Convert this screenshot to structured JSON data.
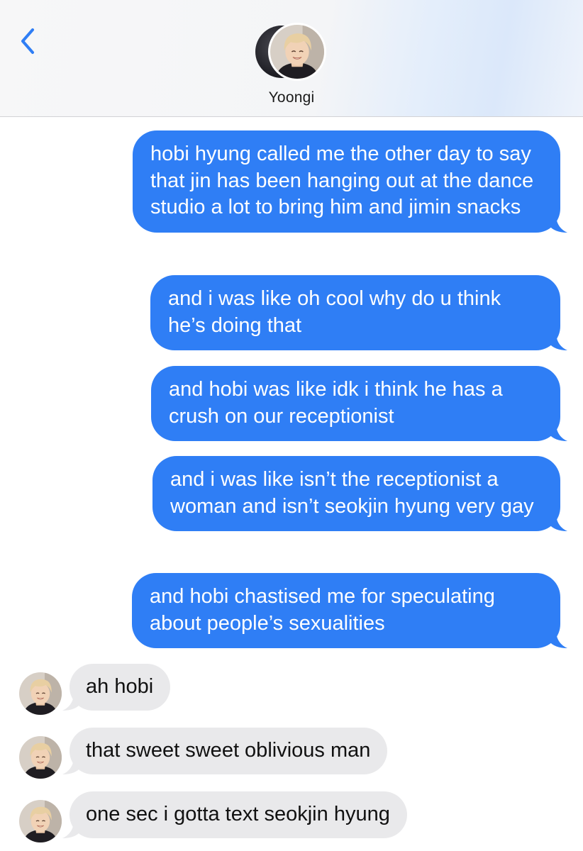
{
  "header": {
    "contact_name": "Yoongi",
    "back_icon": "chevron-left-icon",
    "accent_color": "#2f7ef5"
  },
  "messages": {
    "m1": "hobi hyung called me the other day to say that jin has been hanging out at the dance studio a lot to bring him and jimin snacks",
    "m2": "and i was like oh cool why do u think he’s doing that",
    "m3": "and hobi was like idk i think he has a crush on our receptionist",
    "m4": "and i was like isn’t the receptionist a woman and isn’t seokjin hyung very gay",
    "m5": "and hobi chastised me for speculating about people’s sexualities",
    "r1": "ah hobi",
    "r2": "that sweet sweet oblivious man",
    "r3": "one sec i gotta text seokjin hyung"
  },
  "colors": {
    "outgoing_bubble": "#2f7ef5",
    "incoming_bubble": "#e9e9eb"
  }
}
